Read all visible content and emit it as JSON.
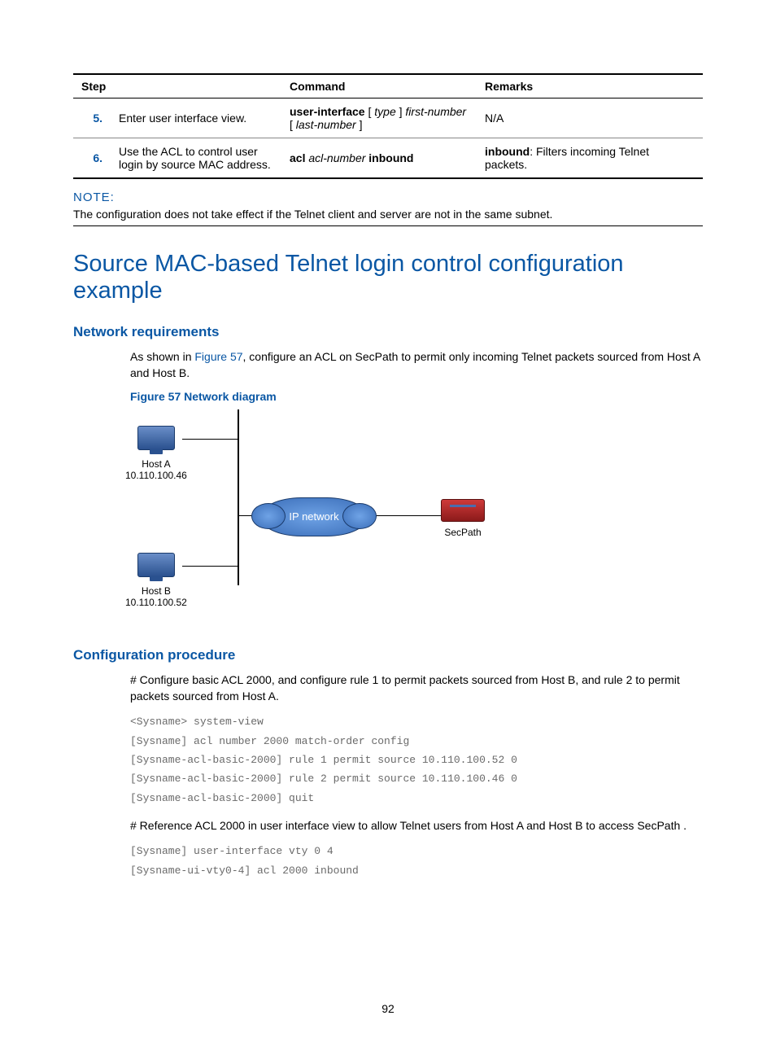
{
  "table": {
    "headers": [
      "Step",
      "Command",
      "Remarks"
    ],
    "rows": [
      {
        "num": "5.",
        "step": "Enter user interface view.",
        "cmd_prefix": "user-interface",
        "cmd_mid1": " [ ",
        "cmd_arg1": "type",
        "cmd_mid2": " ] ",
        "cmd_arg2": "first-number",
        "cmd_mid3": " [ ",
        "cmd_arg3": "last-number",
        "cmd_suffix": " ]",
        "remarks": "N/A"
      },
      {
        "num": "6.",
        "step": "Use the ACL to control user login by source MAC address.",
        "cmd_prefix": "acl",
        "cmd_arg1": " acl-number ",
        "cmd_suffix": "inbound",
        "remarks_bold": "inbound",
        "remarks_rest": ": Filters incoming Telnet packets."
      }
    ]
  },
  "note": {
    "title": "NOTE:",
    "text": "The configuration does not take effect if the Telnet client and server are not in the same subnet."
  },
  "h1": "Source MAC-based Telnet login control configuration example",
  "sec1": {
    "heading": "Network requirements",
    "p_pre": "As shown in ",
    "p_link": "Figure 57",
    "p_post": ", configure an ACL on SecPath to permit only incoming Telnet packets sourced from Host A and Host B.",
    "fig_caption": "Figure 57 Network diagram"
  },
  "diagram": {
    "hostA_name": "Host A",
    "hostA_ip": "10.110.100.46",
    "hostB_name": "Host B",
    "hostB_ip": "10.110.100.52",
    "cloud": "IP network",
    "device": "SecPath"
  },
  "sec2": {
    "heading": "Configuration procedure",
    "p1": "# Configure basic ACL 2000, and configure rule 1 to permit packets sourced from Host B, and rule 2 to permit packets sourced from Host A.",
    "code1": "<Sysname> system-view\n[Sysname] acl number 2000 match-order config\n[Sysname-acl-basic-2000] rule 1 permit source 10.110.100.52 0\n[Sysname-acl-basic-2000] rule 2 permit source 10.110.100.46 0\n[Sysname-acl-basic-2000] quit",
    "p2": "# Reference ACL 2000 in user interface view to allow Telnet users from Host A and Host B to access SecPath .",
    "code2": "[Sysname] user-interface vty 0 4\n[Sysname-ui-vty0-4] acl 2000 inbound"
  },
  "page_num": "92"
}
